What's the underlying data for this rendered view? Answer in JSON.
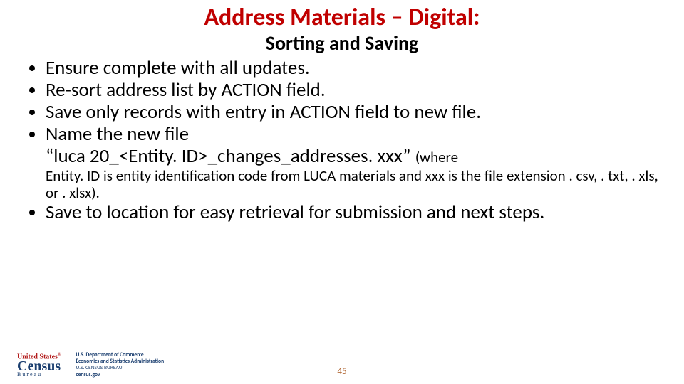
{
  "title": "Address Materials – Digital:",
  "subtitle": "Sorting and Saving",
  "bullets": {
    "b1": "Ensure complete with all updates.",
    "b2": "Re-sort address list by ACTION field.",
    "b3": "Save only records with entry in ACTION field to new file.",
    "b4_lead": "Name the new file ",
    "b4_filename": "“luca 20_<Entity. ID>_changes_addresses. xxx” ",
    "b4_note_open": "(where ",
    "b4_note_rest": "Entity. ID is entity identification code from LUCA materials and xxx is the file extension . csv, . txt, . xls, or . xlsx).",
    "b5": "Save to location for easy retrieval for submission and next steps."
  },
  "footer": {
    "logo_us": "United States",
    "logo_census": "Census",
    "logo_bureau": "Bureau",
    "dept_line1": "U.S. Department of Commerce",
    "dept_line2": "Economics and Statistics Administration",
    "dept_line3": "U.S. CENSUS BUREAU",
    "dept_line4": "census.gov"
  },
  "slide_number": "45"
}
